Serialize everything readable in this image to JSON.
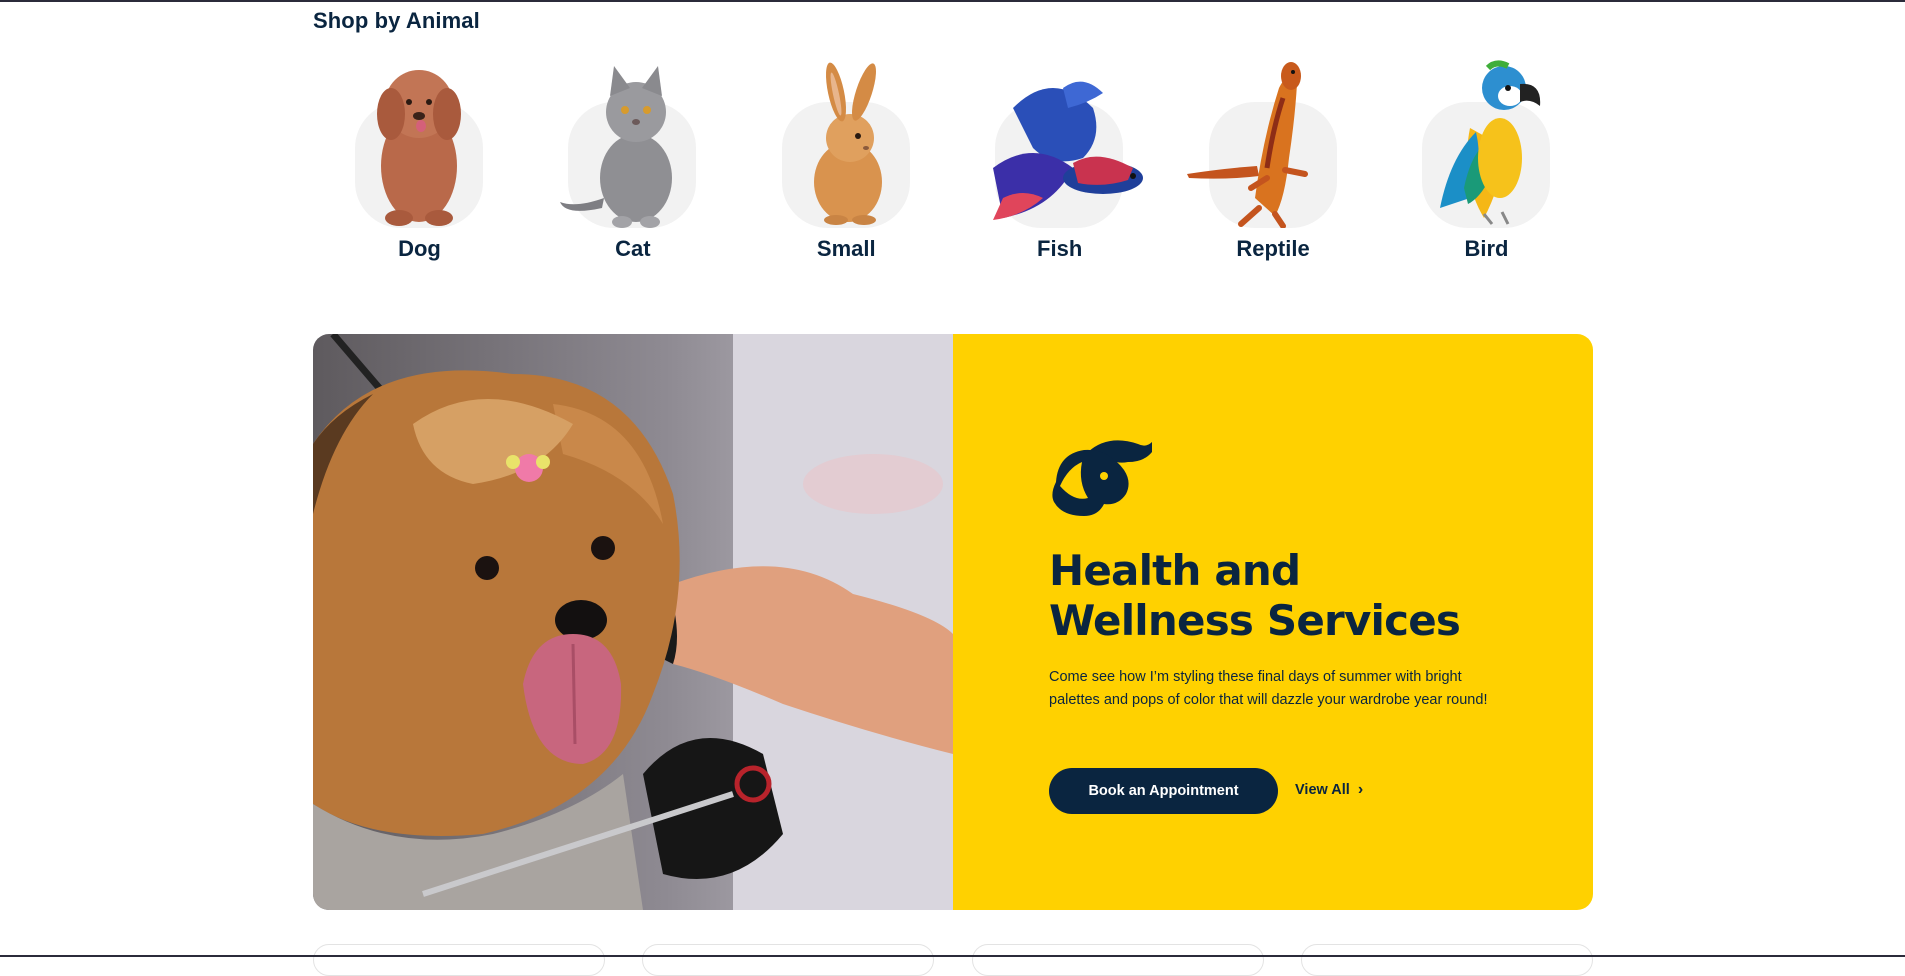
{
  "shop_by_animal": {
    "title": "Shop by Animal",
    "animals": [
      {
        "label": "Dog",
        "icon": "dog-photo"
      },
      {
        "label": "Cat",
        "icon": "cat-photo"
      },
      {
        "label": "Small",
        "icon": "rabbit-photo"
      },
      {
        "label": "Fish",
        "icon": "betta-fish-photo"
      },
      {
        "label": "Reptile",
        "icon": "lizard-photo"
      },
      {
        "label": "Bird",
        "icon": "macaw-photo"
      }
    ]
  },
  "promo": {
    "heading_line1": "Health and",
    "heading_line2": "Wellness Services",
    "description": "Come see how I’m styling these final days of summer with bright palettes and pops of color that will dazzle your wardrobe year round!",
    "primary_button": "Book an Appointment",
    "secondary_link": "View All",
    "icon": "dog-hand-care-icon",
    "image": "groomed-yorkshire-terrier-photo"
  },
  "colors": {
    "navy": "#0a2540",
    "promo_yellow": "#ffd100",
    "avatar_bg": "#f2f2f2"
  }
}
